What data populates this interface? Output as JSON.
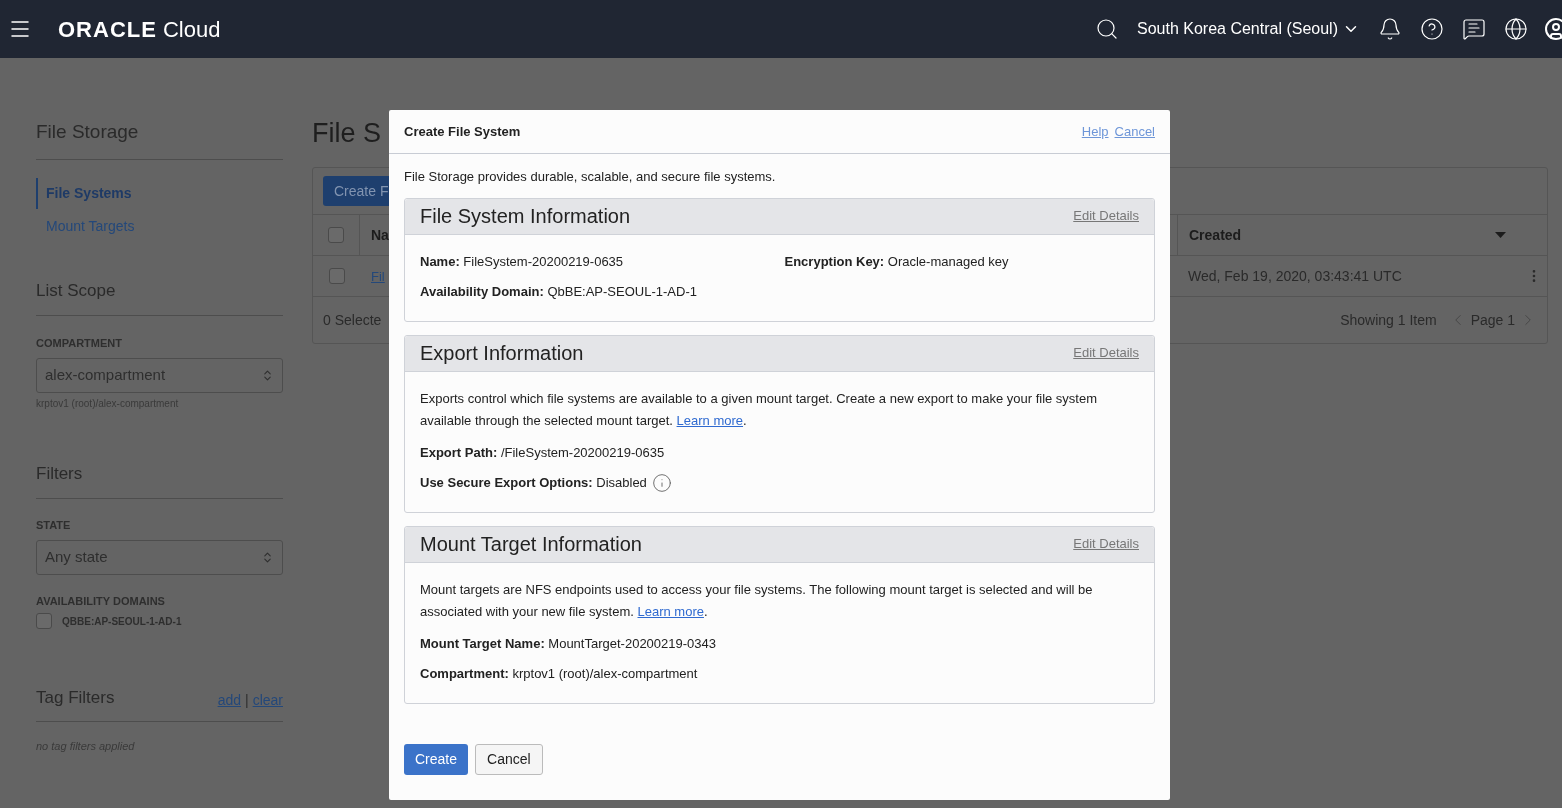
{
  "header": {
    "brand": "ORACLE",
    "product": "Cloud",
    "region": "South Korea Central (Seoul)"
  },
  "sidebar": {
    "title": "File Storage",
    "nav": [
      {
        "label": "File Systems",
        "selected": true
      },
      {
        "label": "Mount Targets",
        "selected": false
      }
    ],
    "scope": {
      "title": "List Scope",
      "compartment_label": "COMPARTMENT",
      "compartment_value": "alex-compartment",
      "compartment_path": "krptov1 (root)/alex-compartment"
    },
    "filters": {
      "title": "Filters",
      "state_label": "STATE",
      "state_value": "Any state",
      "domains_label": "AVAILABILITY DOMAINS",
      "domains": [
        {
          "label": "QBBE:AP-SEOUL-1-AD-1",
          "checked": false
        }
      ]
    },
    "tag_filters": {
      "title": "Tag Filters",
      "add": "add",
      "separator": "|",
      "clear": "clear",
      "empty": "no tag filters applied"
    }
  },
  "main": {
    "title": "File S",
    "create_button": "Create F",
    "all_checked": false,
    "columns": [
      {
        "label": "Na"
      },
      {
        "label": "Created"
      }
    ],
    "rows": [
      {
        "name": "Fil",
        "created": "Wed, Feb 19, 2020, 03:43:41 UTC",
        "checked": false
      }
    ],
    "footer": {
      "selected": "0 Selecte",
      "showing": "Showing 1 Item",
      "page": "Page 1"
    }
  },
  "dialog": {
    "title": "Create File System",
    "help": "Help",
    "cancel": "Cancel",
    "description": "File Storage provides durable, scalable, and secure file systems.",
    "sections": [
      {
        "title": "File System Information",
        "edit": "Edit Details",
        "rows": [
          [
            {
              "text": "**Name:** FileSystem-20200219-0635",
              "info": false
            },
            {
              "text": "**Encryption Key:** Oracle-managed key",
              "info": false
            }
          ],
          [
            {
              "text": "**Availability Domain:** QbBE:AP-SEOUL-1-AD-1",
              "info": false
            }
          ]
        ]
      },
      {
        "title": "Export Information",
        "edit": "Edit Details",
        "intro": {
          "text": "Exports control which file systems are available to a given mount target. Create a new export to make your file system available through the selected mount target. ",
          "link": "Learn more",
          "after": "."
        },
        "rows": [
          [
            {
              "text": "**Export Path:** /FileSystem-20200219-0635",
              "info": false
            }
          ],
          [
            {
              "text": "**Use Secure Export Options:** Disabled",
              "info": true
            }
          ]
        ]
      },
      {
        "title": "Mount Target Information",
        "edit": "Edit Details",
        "intro": {
          "text": "Mount targets are NFS endpoints used to access your file systems. The following mount target is selected and will be associated with your new file system. ",
          "link": "Learn more",
          "after": "."
        },
        "rows": [
          [
            {
              "text": "**Mount Target Name:** MountTarget-20200219-0343",
              "info": false
            }
          ],
          [
            {
              "text": "**Compartment:** krptov1 (root)/alex-compartment",
              "info": false
            }
          ]
        ]
      }
    ],
    "buttons": [
      {
        "label": "Create",
        "kind": "primary"
      },
      {
        "label": "Cancel",
        "kind": "secondary"
      }
    ]
  }
}
